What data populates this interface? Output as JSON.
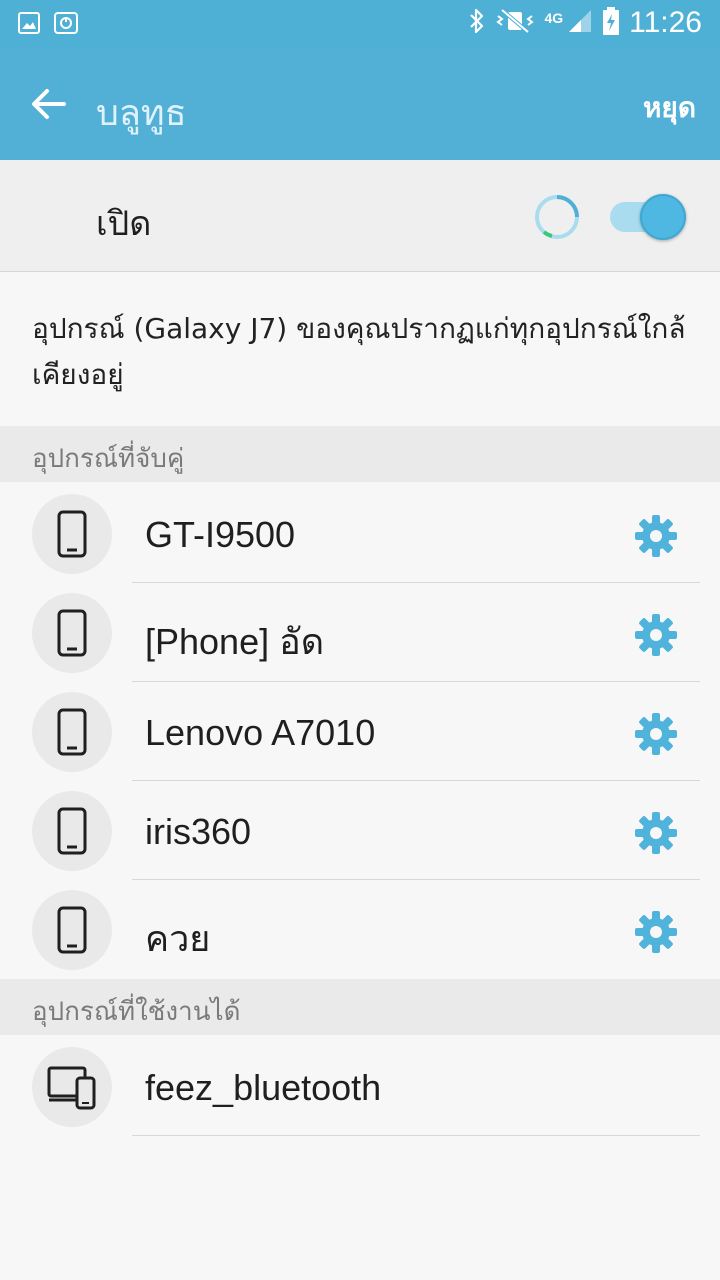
{
  "status_bar": {
    "time": "11:26",
    "network_type": "4G",
    "icons": [
      "gallery-icon",
      "screen-icon",
      "bluetooth-icon",
      "vibrate-mute-icon",
      "signal-icon",
      "battery-charging-icon"
    ]
  },
  "app_bar": {
    "title": "บลูทูธ",
    "stop_label": "หยุด"
  },
  "master": {
    "label": "เปิด",
    "enabled": true
  },
  "visibility_text": "อุปกรณ์ (Galaxy J7) ของคุณปรากฏแก่ทุกอุปกรณ์ใกล้เคียงอยู่",
  "paired": {
    "header": "อุปกรณ์ที่จับคู่",
    "devices": [
      {
        "name": "GT-I9500",
        "icon": "phone-icon"
      },
      {
        "name": "[Phone] อัด",
        "icon": "phone-icon"
      },
      {
        "name": "Lenovo A7010",
        "icon": "phone-icon"
      },
      {
        "name": "iris360",
        "icon": "phone-icon"
      },
      {
        "name": "ควย",
        "icon": "phone-icon"
      }
    ]
  },
  "available": {
    "header": "อุปกรณ์ที่ใช้งานได้",
    "devices": [
      {
        "name": "feez_bluetooth",
        "icon": "computer-phone-icon"
      }
    ]
  },
  "colors": {
    "accent": "#52b0d7",
    "gear": "#4fb3dc"
  }
}
